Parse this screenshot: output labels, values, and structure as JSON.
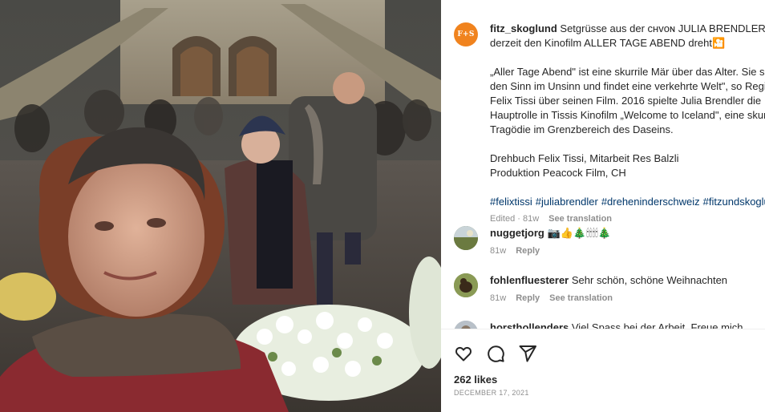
{
  "post": {
    "author": {
      "username": "fitz_skoglund",
      "avatar_text": "F+S",
      "avatar_color": "#f0831e"
    },
    "caption_lines": [
      "Setgrüsse aus der ᴄʜᴠᴏɴ JULIA BRENDLER, die",
      "derzeit den Kinofilm ALLER TAGE ABEND dreht🎦",
      "",
      "„Aller Tage Abend\" ist eine skurrile Mär über das Alter. Sie sucht",
      "den Sinn im Unsinn und findet eine verkehrte Welt\", so Regisseur",
      "Felix Tissi über seinen Film. 2016 spielte Julia Brendler die",
      "Hauptrolle in Tissis Kinofilm „Welcome to Iceland\", eine skurrile",
      "Tragödie im Grenzbereich des Daseins.",
      "",
      "Drehbuch Felix Tissi, Mitarbeit Res Balzli",
      "Produktion Peacock Film, CH"
    ],
    "hashtags": [
      "#felixtissi",
      "#juliabrendler",
      "#dreheninderschweiz",
      "#fitzundskoglund"
    ],
    "meta": {
      "edited": "Edited · 81w",
      "see_translation": "See translation"
    },
    "likes": "262 likes",
    "date": "DECEMBER 17, 2021"
  },
  "comments": [
    {
      "username": "nuggetjorg",
      "text": "📷👍🎄🕯🕯🕯🕯🎄",
      "age": "81w",
      "reply": "Reply",
      "see_translation": ""
    },
    {
      "username": "fohlenfluesterer",
      "text": "Sehr schön, schöne Weihnachten",
      "age": "81w",
      "reply": "Reply",
      "see_translation": "See translation"
    },
    {
      "username": "horsthollenders",
      "text": "Viel Spass bei der Arbeit. Freue mich schon",
      "age": "",
      "reply": "",
      "see_translation": ""
    }
  ],
  "actions": {
    "like_icon": "heart-icon",
    "comment_icon": "comment-icon",
    "share_icon": "share-icon"
  }
}
